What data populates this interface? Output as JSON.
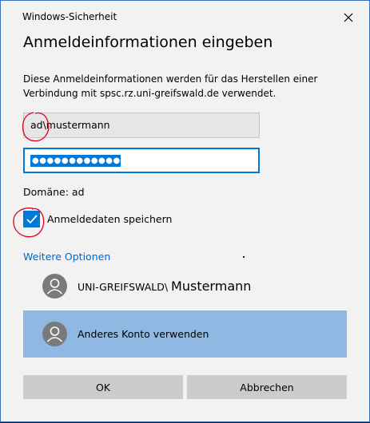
{
  "window": {
    "title": "Windows-Sicherheit",
    "heading": "Anmeldeinformationen eingeben"
  },
  "description": {
    "line1": "Diese Anmeldeinformationen werden für das Herstellen einer",
    "line2": "Verbindung mit  spsc.rz.uni-greifswald.de verwendet."
  },
  "form": {
    "username_value": "ad\\mustermann",
    "password_mask": "●●●●●●●●●●●●●●",
    "domain_text": "Domäne: ad",
    "remember_label": "Anmeldedaten speichern",
    "remember_checked": true
  },
  "more_options": "Weitere Optionen",
  "accounts": [
    {
      "prefix": "UNI-GREIFSWALD\\ ",
      "name": "Mustermann",
      "selected": false
    },
    {
      "prefix": "Anderes Konto verwenden",
      "name": "",
      "selected": true
    }
  ],
  "buttons": {
    "ok": "OK",
    "cancel": "Abbrechen"
  },
  "colors": {
    "accent": "#0078d7",
    "link": "#0066cc",
    "selected_row": "#8fb9e2",
    "annotation": "#e0001b"
  }
}
